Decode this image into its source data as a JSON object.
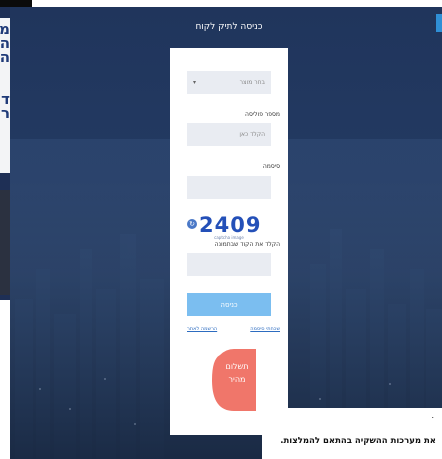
{
  "modal": {
    "title": "כניסה לתיק לקוח",
    "select_placeholder": "בחר מוצר",
    "policy_label": "מספר פוליסה",
    "policy_placeholder": "הקלד כאן",
    "password_label": "סיסמה",
    "captcha_value": "2409",
    "captcha_caption": "captcha image",
    "captcha_prompt": "הקלד את הקוד שבתמונה",
    "login_button": "כניסה",
    "forgot_password_link": "שכחתי סיסמה",
    "register_link": "הרשמה לאתר",
    "payment_line1": "תשלום",
    "payment_line2": "מהיר"
  },
  "background_page": {
    "bottom_line_1": ".",
    "bottom_line_2": "את מערכות ההשקיה בהתאם להמלצות."
  },
  "colors": {
    "overlay": "#20355c",
    "login_button": "#7bbef0",
    "payment_badge": "#f0766a",
    "captcha_text": "#2450b8",
    "field_bg": "#e9ecf2"
  }
}
